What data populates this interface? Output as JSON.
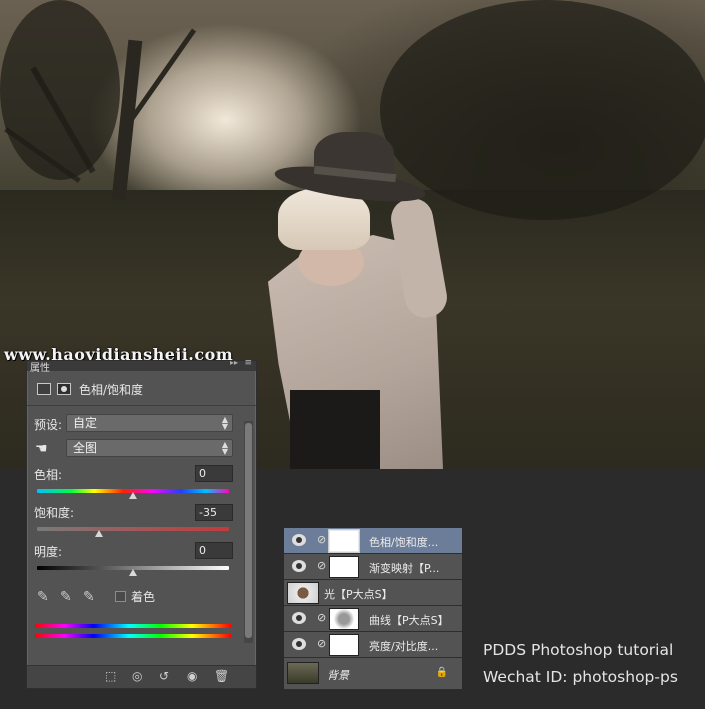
{
  "watermark": "www.haoyidiansheji.com",
  "properties_panel": {
    "tab_label": "属性",
    "tab_arrows": "▸▸",
    "menu_icon": "≡",
    "title": "色相/饱和度",
    "preset_label": "预设:",
    "preset_value": "自定",
    "channel_value": "全图",
    "hue_label": "色相:",
    "hue_value": "0",
    "hue_level": 0.5,
    "saturation_label": "饱和度:",
    "saturation_value": "-35",
    "saturation_level": 0.325,
    "lightness_label": "明度:",
    "lightness_value": "0",
    "lightness_level": 0.5,
    "colorize_label": "着色",
    "colorize_checked": false
  },
  "layers_panel": {
    "layers": [
      {
        "name": "色相/饱和度...",
        "type": "adjustment",
        "visible": true,
        "selected": true
      },
      {
        "name": "渐变映射【P...",
        "type": "adjustment",
        "visible": true,
        "selected": false
      },
      {
        "name": "光【P大点S】",
        "type": "pixel",
        "visible": false,
        "selected": false
      },
      {
        "name": "曲线【P大点S】",
        "type": "adjustment",
        "visible": true,
        "selected": false
      },
      {
        "name": "亮度/对比度...",
        "type": "adjustment",
        "visible": true,
        "selected": false
      },
      {
        "name": "背景",
        "type": "background",
        "visible": false,
        "selected": false,
        "locked": true
      }
    ]
  },
  "credit": {
    "line1": "PDDS Photoshop tutorial",
    "line2": "Wechat ID: photoshop-ps"
  },
  "colors": {
    "panel_bg": "#535353",
    "selected_layer": "#6c7d99",
    "saturation_track": "#c43a3a"
  }
}
